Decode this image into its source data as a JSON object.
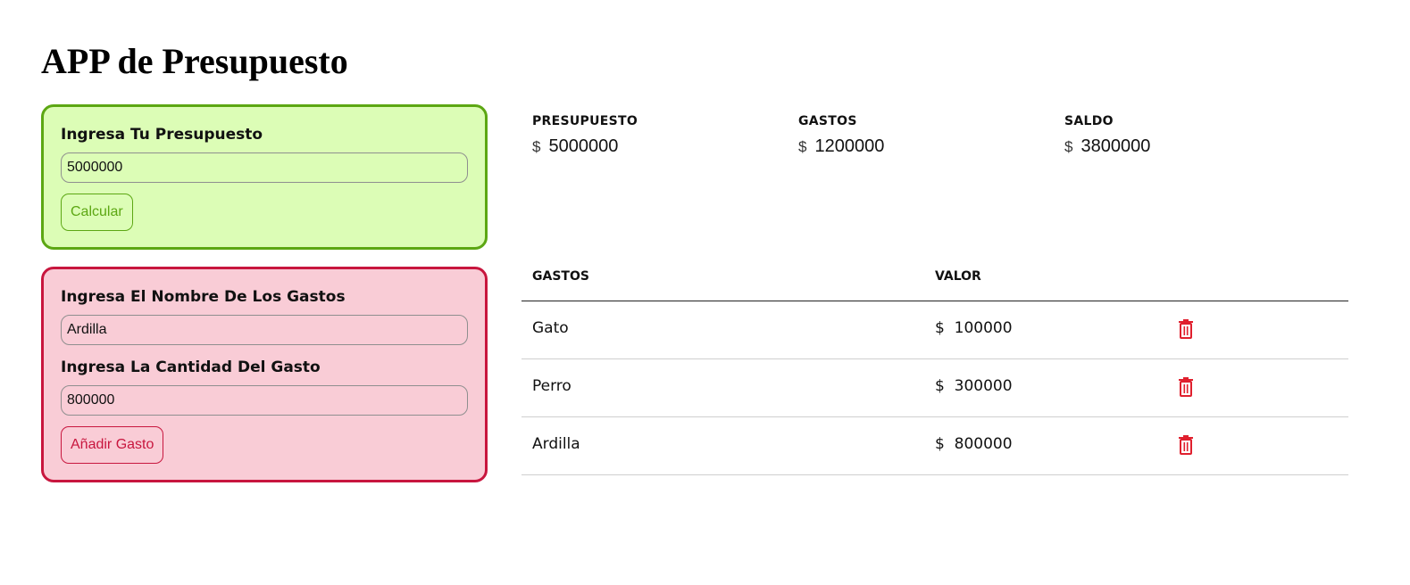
{
  "app": {
    "title": "APP de Presupuesto"
  },
  "budget_form": {
    "label": "Ingresa Tu Presupuesto",
    "value": "5000000",
    "button_label": "Calcular"
  },
  "expense_form": {
    "name_label": "Ingresa El Nombre De Los Gastos",
    "name_value": "Ardilla",
    "amount_label": "Ingresa La Cantidad Del Gasto",
    "amount_value": "800000",
    "button_label": "Añadir Gasto"
  },
  "summary": {
    "budget": {
      "label": "PRESUPUESTO",
      "currency": "$",
      "amount": "5000000"
    },
    "expenses": {
      "label": "GASTOS",
      "currency": "$",
      "amount": "1200000"
    },
    "balance": {
      "label": "SALDO",
      "currency": "$",
      "amount": "3800000"
    }
  },
  "table": {
    "headers": {
      "name": "GASTOS",
      "value": "VALOR"
    },
    "rows": [
      {
        "name": "Gato",
        "currency": "$",
        "amount": "100000"
      },
      {
        "name": "Perro",
        "currency": "$",
        "amount": "300000"
      },
      {
        "name": "Ardilla",
        "currency": "$",
        "amount": "800000"
      }
    ],
    "delete_icon": "trash-icon"
  },
  "colors": {
    "green_accent": "#5ca713",
    "green_bg": "#dcfdb6",
    "red_accent": "#c8163e",
    "red_bg": "#f9ccd6",
    "delete_icon": "#e0202e"
  }
}
